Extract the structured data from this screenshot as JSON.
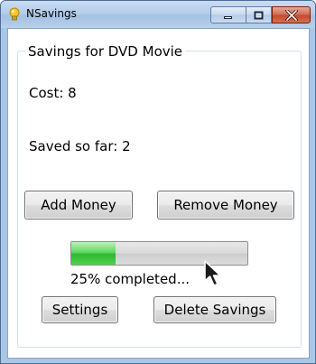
{
  "window": {
    "title": "NSavings",
    "icon": "lightbulb-icon"
  },
  "titlebar_buttons": {
    "minimize_icon": "minimize-icon",
    "maximize_icon": "maximize-icon",
    "close_icon": "close-icon"
  },
  "group": {
    "title": "Savings for DVD Movie",
    "cost_label": "Cost: 8",
    "saved_label": "Saved so far: 2"
  },
  "buttons": {
    "add_money": "Add Money",
    "remove_money": "Remove Money",
    "settings": "Settings",
    "delete_savings": "Delete Savings"
  },
  "progress": {
    "fraction": 0.25,
    "text": "25% completed..."
  },
  "colors": {
    "progress_green": "#2eb82e",
    "close_red": "#c24a2e"
  }
}
